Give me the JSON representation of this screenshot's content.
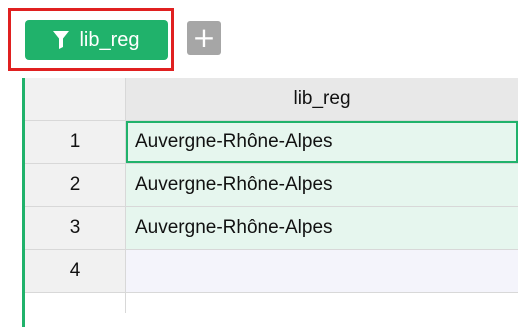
{
  "toolbar": {
    "filter_button_label": "lib_reg",
    "filter_icon": "funnel-icon",
    "add_button_label": "+",
    "add_icon": "plus-icon"
  },
  "colors": {
    "accent": "#20b26b",
    "highlight": "#e02020",
    "add_button": "#a6a6a6"
  },
  "grid": {
    "column_header": "lib_reg",
    "rows": [
      {
        "number": "1",
        "value": "Auvergne-Rhône-Alpes"
      },
      {
        "number": "2",
        "value": "Auvergne-Rhône-Alpes"
      },
      {
        "number": "3",
        "value": "Auvergne-Rhône-Alpes"
      },
      {
        "number": "4",
        "value": ""
      }
    ]
  }
}
